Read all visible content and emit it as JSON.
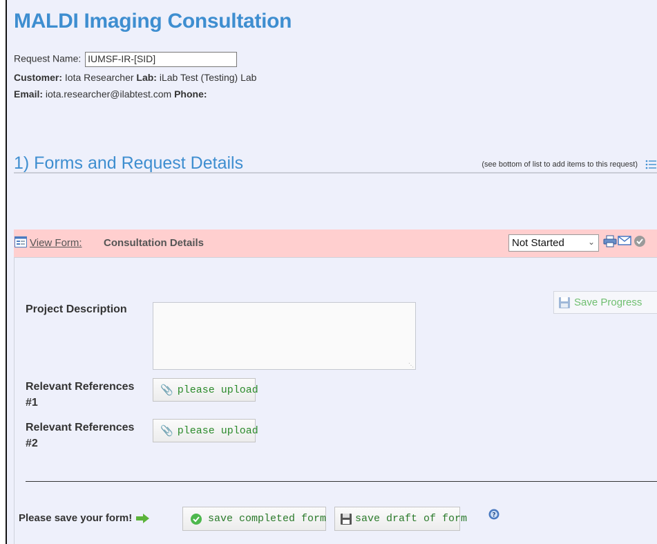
{
  "page": {
    "title": "MALDI Imaging Consultation",
    "request_name_label": "Request Name:",
    "request_name_value": "IUMSF-IR-[SID]",
    "customer_label": "Customer:",
    "customer_value": "Iota Researcher",
    "lab_label": "Lab:",
    "lab_value": "iLab Test (Testing) Lab",
    "email_label": "Email:",
    "email_value": "iota.researcher@ilabtest.com",
    "phone_label": "Phone:",
    "phone_value": ""
  },
  "section": {
    "title": "1) Forms and Request Details",
    "hint": "(see bottom of list to add items to this request)"
  },
  "form_bar": {
    "view_form_label": "View Form:",
    "form_name": "Consultation Details",
    "status_selected": "Not Started"
  },
  "form": {
    "save_progress_label": "Save Progress",
    "fields": [
      {
        "label": "Project Description",
        "value": ""
      },
      {
        "label_line1": "Relevant References",
        "label_line2": "#1",
        "button": "please upload"
      },
      {
        "label_line1": "Relevant References",
        "label_line2": "#2",
        "button": "please upload"
      }
    ],
    "save_prompt": "Please save your form!",
    "save_completed_label": "save completed form",
    "save_draft_label": "save draft of form"
  },
  "icons": {
    "list": "list-icon",
    "view_form": "form-icon",
    "print": "print-icon",
    "email": "email-icon",
    "status": "check-circle-icon",
    "save": "floppy-icon",
    "attach": "paperclip-icon",
    "arrow": "arrow-right-icon",
    "help": "help-icon"
  },
  "colors": {
    "title_blue": "#3e8ed0",
    "form_bar_bg": "#ffcfcf",
    "page_bg": "#eef0fb",
    "button_green": "#2a8a2a"
  }
}
